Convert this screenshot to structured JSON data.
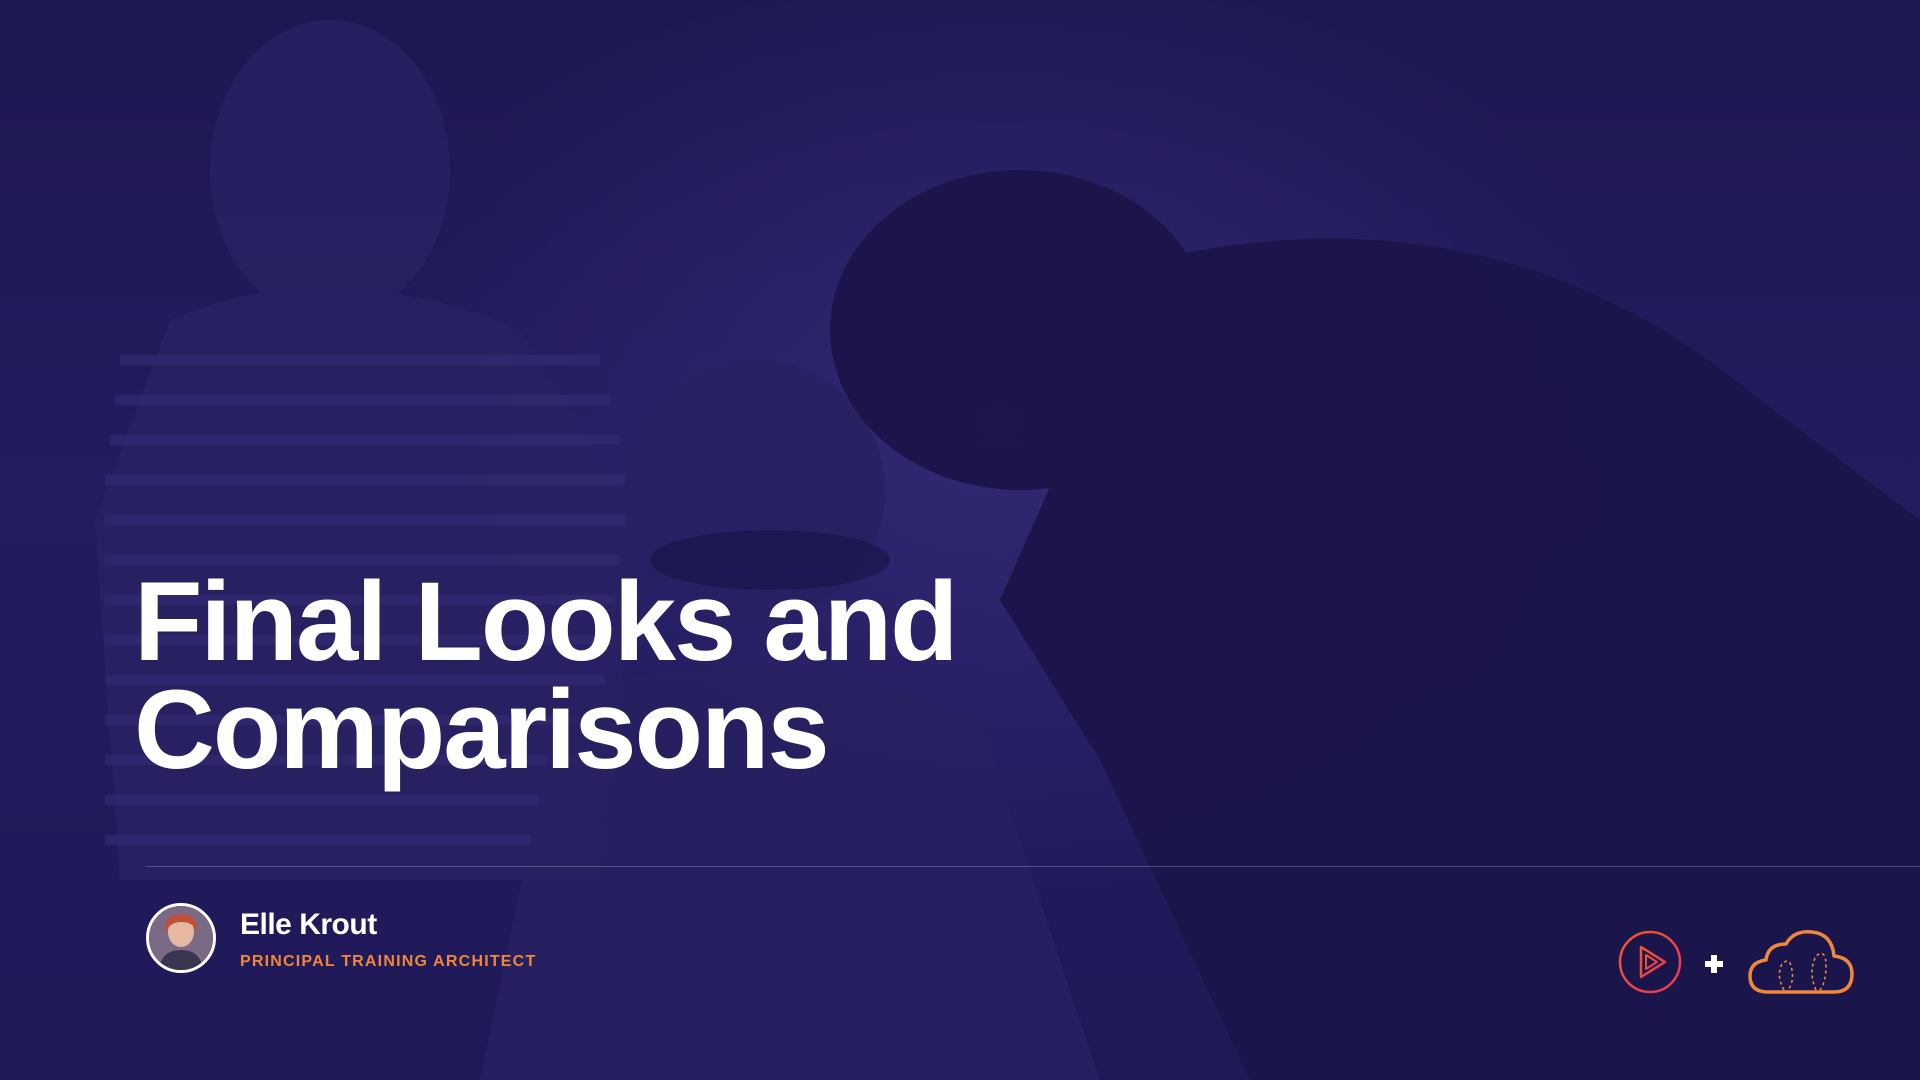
{
  "slide": {
    "title_line1": "Final Looks and",
    "title_line2": "Comparisons",
    "presenter": {
      "name": "Elle Krout",
      "role": "PRINCIPAL TRAINING ARCHITECT"
    },
    "colors": {
      "background": "#1f1a55",
      "accent_orange": "#f0863a",
      "accent_pink": "#e8365d",
      "title_text": "#ffffff"
    },
    "icons": {
      "left_logo": "play-logo-icon",
      "separator": "plus-icon",
      "right_logo": "cloud-logo-icon"
    }
  }
}
